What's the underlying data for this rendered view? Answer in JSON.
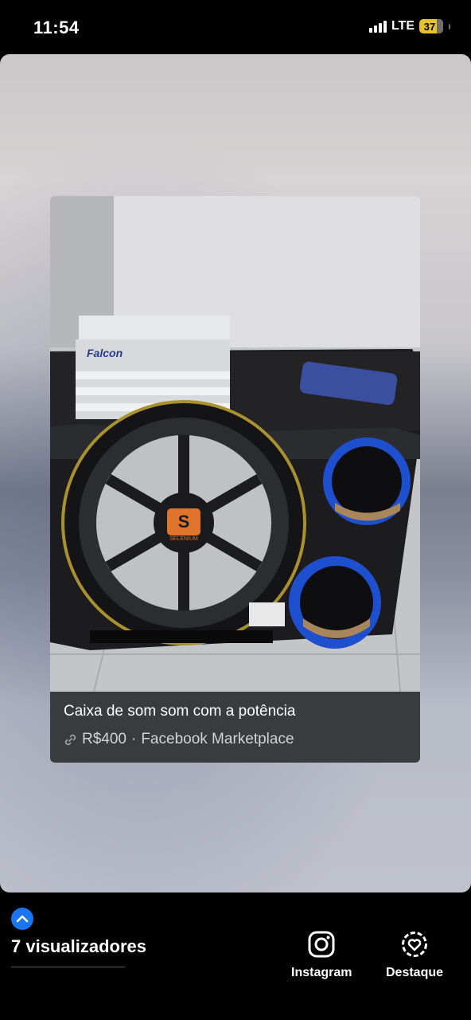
{
  "status_bar": {
    "time": "11:54",
    "network": "LTE",
    "battery_level": "37",
    "battery_color": "#e7c22a"
  },
  "post": {
    "title": "Caixa de som som com a potência",
    "price": "R$400",
    "separator": "·",
    "source": "Facebook Marketplace",
    "link_icon": "link-icon",
    "image_brand_amp": "Falcon",
    "image_brand_sub": "SELENIUM"
  },
  "bottom": {
    "viewers": "7 visualizadores",
    "actions": [
      {
        "label": "Instagram",
        "icon": "instagram-icon"
      },
      {
        "label": "Destaque",
        "icon": "highlight-heart-icon"
      }
    ],
    "accent": "#1a76f0"
  }
}
